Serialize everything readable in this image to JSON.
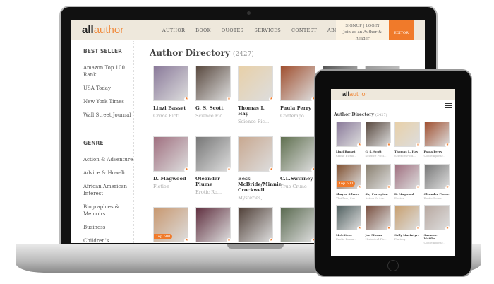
{
  "header": {
    "logo": "allauthor",
    "logo_a": "all",
    "logo_b": "author",
    "nav": [
      "AUTHOR",
      "BOOK",
      "QUOTES",
      "SERVICES",
      "CONTEST",
      "ABOUT"
    ],
    "signup": "SIGNUP",
    "login": "LOGIN",
    "join": "Join as an Author & Reader",
    "editor": "EDITOR"
  },
  "sidebar": {
    "best_seller": "BEST SELLER",
    "best_items": [
      "Amazon Top 100 Rank",
      "USA Today",
      "New York Times",
      "Wall Street Journal"
    ],
    "genre": "GENRE",
    "genre_items": [
      "Action & Adventure",
      "Advice & How-To",
      "African American Interest",
      "Biographies & Memoirs",
      "Business",
      "Children's"
    ]
  },
  "main": {
    "title": "Author Directory",
    "count": "(2427)",
    "badge": "Top 500",
    "authors": [
      {
        "name": "Linzi Basset",
        "genre": "Crime Ficti...",
        "color": "#8a7a9a"
      },
      {
        "name": "G. S. Scott",
        "genre": "Science Fic...",
        "color": "#5a4a40"
      },
      {
        "name": "Thomas L. Hay",
        "genre": "Science Fic...",
        "color": "#e8d0a8"
      },
      {
        "name": "Paula Perry",
        "genre": "Contempo...",
        "color": "#a05030"
      },
      {
        "name": "",
        "genre": "",
        "color": "#555"
      },
      {
        "name": "",
        "genre": "",
        "color": "#999"
      },
      {
        "name": "D. Magwood",
        "genre": "Fiction",
        "color": "#a07080"
      },
      {
        "name": "Oleander Plume",
        "genre": "Erotic Ro...",
        "color": "#777"
      },
      {
        "name": "Bess McBride/Minnie Crockwell",
        "genre": "Mysteries, ...",
        "color": "#c8a890"
      },
      {
        "name": "C.L.Swinney",
        "genre": "True Crime",
        "color": "#607050"
      },
      {
        "name": "",
        "genre": "",
        "color": "#888"
      },
      {
        "name": "",
        "genre": "",
        "color": "#aaa"
      },
      {
        "name": "",
        "genre": "",
        "color": "#c89870",
        "top": true
      },
      {
        "name": "",
        "genre": "",
        "color": "#603040"
      },
      {
        "name": "",
        "genre": "",
        "color": "#504038"
      },
      {
        "name": "",
        "genre": "",
        "color": "#5a6a50"
      }
    ]
  },
  "tablet": {
    "title": "Author Directory",
    "count": "(2427)",
    "badge": "Top 500",
    "authors": [
      {
        "name": "Linzi Basset",
        "genre": "Crime Fictio...",
        "color": "#8a7a9a"
      },
      {
        "name": "G. S. Scott",
        "genre": "Science Ficti...",
        "color": "#5a4a40"
      },
      {
        "name": "Thomas L. Hay",
        "genre": "Science Ficti...",
        "color": "#e8d0a8"
      },
      {
        "name": "Paula Perry",
        "genre": "Contemporar...",
        "color": "#a05030"
      },
      {
        "name": "Shayne Silvers",
        "genre": "Thrillers, Sus...",
        "color": "#805030",
        "top": true
      },
      {
        "name": "Sky Purington",
        "genre": "Action & Adv...",
        "color": "#8a8070"
      },
      {
        "name": "D. Magwood",
        "genre": "Fiction",
        "color": "#a07080"
      },
      {
        "name": "Oleander Plume",
        "genre": "Erotic Roma...",
        "color": "#777"
      },
      {
        "name": "M.A.Stone",
        "genre": "Erotic Roma...",
        "color": "#506060"
      },
      {
        "name": "Jan Moran",
        "genre": "Historical Fic...",
        "color": "#7a5040"
      },
      {
        "name": "Sally MacIntyre",
        "genre": "Fantasy",
        "color": "#c8a070"
      },
      {
        "name": "Suzanne Matthe...",
        "genre": "Contemporar...",
        "color": "#b8a8a0"
      }
    ]
  }
}
